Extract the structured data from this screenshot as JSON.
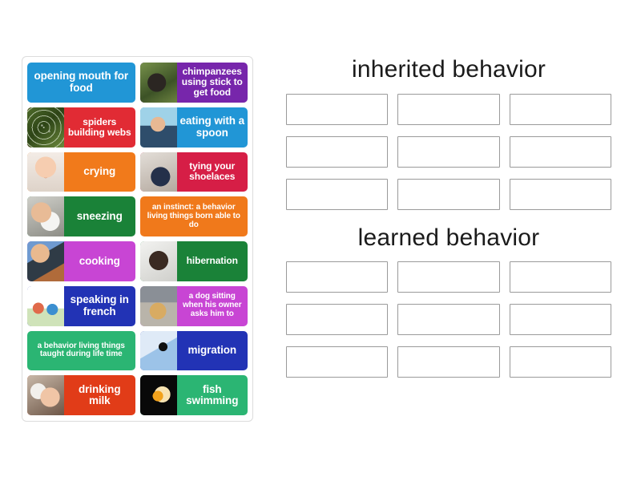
{
  "activity": {
    "type": "group-sort",
    "tile_tray": {
      "columns": [
        {
          "tiles": [
            {
              "label": "opening mouth for food",
              "color": "#2196d6",
              "thumb": null,
              "size": "lg"
            },
            {
              "label": "spiders building webs",
              "color": "#e12b34",
              "thumb": "art-spiderweb",
              "size": "md"
            },
            {
              "label": "crying",
              "color": "#f17a1b",
              "thumb": "art-baby",
              "size": "lg"
            },
            {
              "label": "sneezing",
              "color": "#1a8238",
              "thumb": "art-sneeze",
              "size": "lg"
            },
            {
              "label": "cooking",
              "color": "#c845d4",
              "thumb": "art-cooking",
              "size": "lg"
            },
            {
              "label": "speaking in french",
              "color": "#2233b5",
              "thumb": "art-speaking",
              "size": "lg"
            },
            {
              "label": "a behavior living things taught during life time",
              "color": "#2bb573",
              "thumb": null,
              "size": "sm"
            },
            {
              "label": "drinking milk",
              "color": "#e13c18",
              "thumb": "art-milk",
              "size": "lg"
            }
          ]
        },
        {
          "tiles": [
            {
              "label": "chimpanzees using stick to get food",
              "color": "#7726ab",
              "thumb": "art-chimp",
              "size": "md"
            },
            {
              "label": "eating with a spoon",
              "color": "#2196d6",
              "thumb": "art-spoon",
              "size": "lg"
            },
            {
              "label": "tying your shoelaces",
              "color": "#d61e46",
              "thumb": "art-shoelace",
              "size": "md"
            },
            {
              "label": "an instinct: a behavior living things born able to do",
              "color": "#f0791b",
              "thumb": null,
              "size": "sm"
            },
            {
              "label": "hibernation",
              "color": "#1a8238",
              "thumb": "art-hibernation",
              "size": "md"
            },
            {
              "label": "a dog sitting when his owner asks him to",
              "color": "#c845d4",
              "thumb": "art-dog",
              "size": "sm"
            },
            {
              "label": "migration",
              "color": "#2233b5",
              "thumb": "art-migration",
              "size": "lg"
            },
            {
              "label": "fish swimming",
              "color": "#2bb573",
              "thumb": "art-fish",
              "size": "lg"
            }
          ]
        }
      ]
    },
    "categories": [
      {
        "title": "inherited behavior",
        "slots": [
          "",
          "",
          "",
          "",
          "",
          "",
          "",
          "",
          ""
        ]
      },
      {
        "title": "learned behavior",
        "slots": [
          "",
          "",
          "",
          "",
          "",
          "",
          "",
          "",
          ""
        ]
      }
    ]
  },
  "colors": {
    "page_background": "#ffffff",
    "tray_border": "#dcdcdc",
    "dropzone_border": "#9a9a9a",
    "title_text": "#1b1b1b",
    "tile_text": "#ffffff"
  }
}
